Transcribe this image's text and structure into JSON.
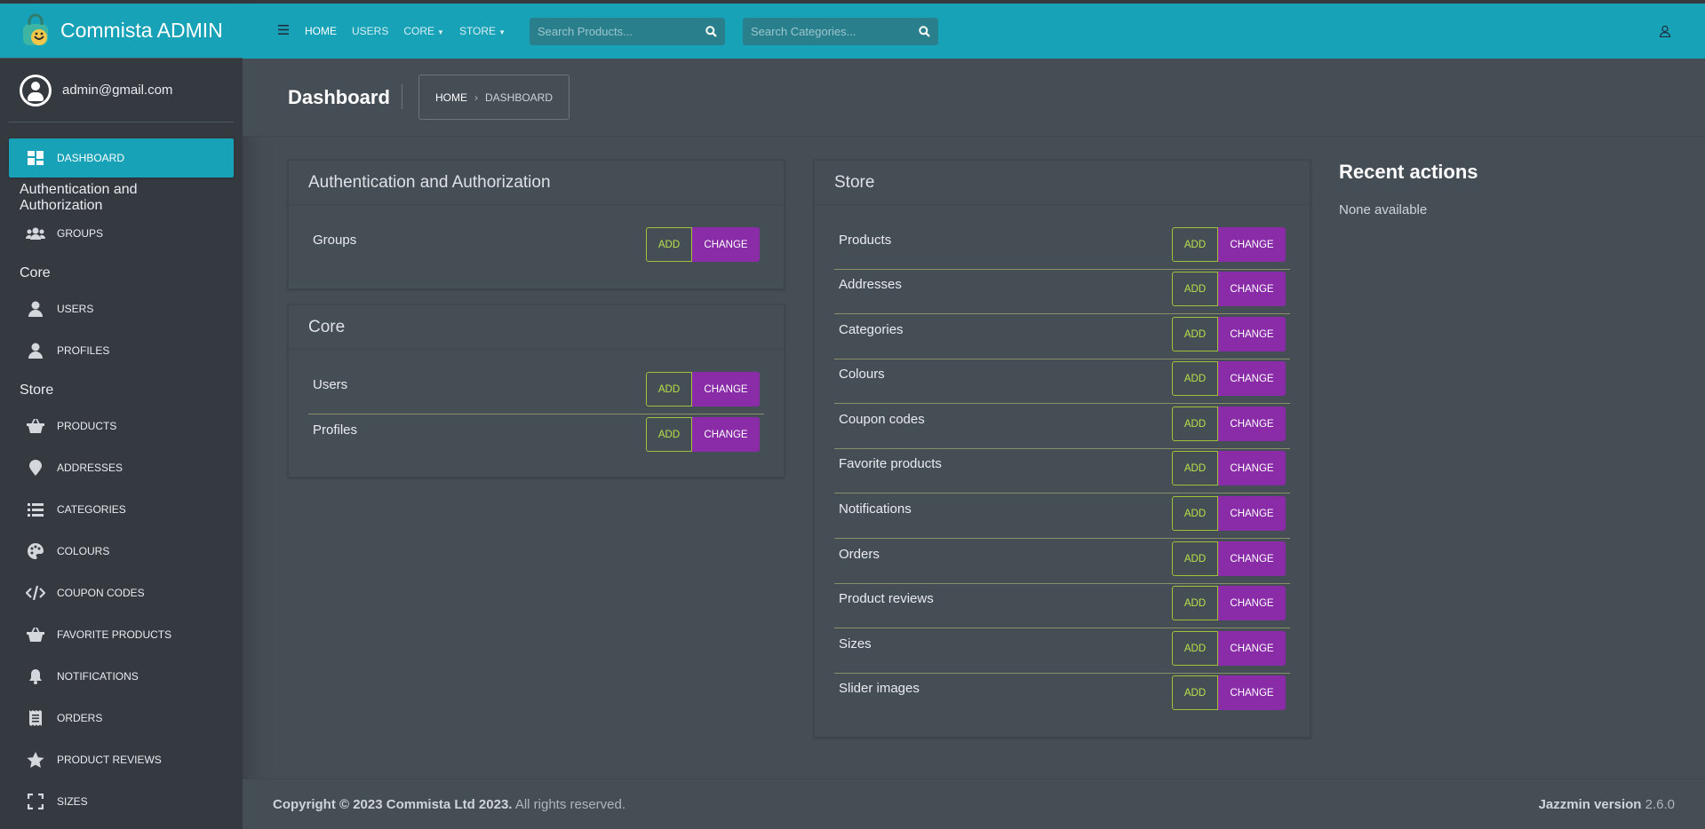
{
  "brand": {
    "name": "Commista ADMIN"
  },
  "user": {
    "email": "admin@gmail.com"
  },
  "sidebar": {
    "dashboard": "Dashboard",
    "sections": [
      {
        "title": "Authentication and Authorization",
        "items": [
          {
            "label": "Groups",
            "icon": "users-icon"
          }
        ]
      },
      {
        "title": "Core",
        "items": [
          {
            "label": "Users",
            "icon": "user-icon"
          },
          {
            "label": "Profiles",
            "icon": "user-icon"
          }
        ]
      },
      {
        "title": "Store",
        "items": [
          {
            "label": "Products",
            "icon": "basket-icon"
          },
          {
            "label": "Addresses",
            "icon": "map-pin-icon"
          },
          {
            "label": "Categories",
            "icon": "list-icon"
          },
          {
            "label": "Colours",
            "icon": "palette-icon"
          },
          {
            "label": "Coupon codes",
            "icon": "code-icon"
          },
          {
            "label": "Favorite products",
            "icon": "basket-icon"
          },
          {
            "label": "Notifications",
            "icon": "bell-icon"
          },
          {
            "label": "Orders",
            "icon": "receipt-icon"
          },
          {
            "label": "Product reviews",
            "icon": "star-icon"
          },
          {
            "label": "Sizes",
            "icon": "expand-icon"
          }
        ]
      }
    ]
  },
  "navbar": {
    "home": "Home",
    "users": "Users",
    "core": "Core",
    "store": "Store",
    "search_products_placeholder": "Search Products...",
    "search_categories_placeholder": "Search Categories..."
  },
  "header": {
    "title": "Dashboard",
    "breadcrumb_home": "Home",
    "breadcrumb_current": "Dashboard"
  },
  "buttons": {
    "add": "ADD",
    "change": "CHANGE"
  },
  "apps": {
    "auth": {
      "title": "Authentication and Authorization",
      "models": [
        "Groups"
      ]
    },
    "core": {
      "title": "Core",
      "models": [
        "Users",
        "Profiles"
      ]
    },
    "store": {
      "title": "Store",
      "models": [
        "Products",
        "Addresses",
        "Categories",
        "Colours",
        "Coupon codes",
        "Favorite products",
        "Notifications",
        "Orders",
        "Product reviews",
        "Sizes",
        "Slider images"
      ]
    }
  },
  "recent": {
    "title": "Recent actions",
    "empty": "None available"
  },
  "footer": {
    "copyright": "Copyright © 2023 Commista Ltd 2023.",
    "rights": "All rights reserved.",
    "version_label": "Jazzmin version",
    "version": "2.6.0"
  },
  "colors": {
    "accent": "#17a2b8",
    "change_button": "#8a2ba8",
    "add_border": "#9fc23a",
    "background": "#454d55",
    "sidebar": "#343a40"
  }
}
